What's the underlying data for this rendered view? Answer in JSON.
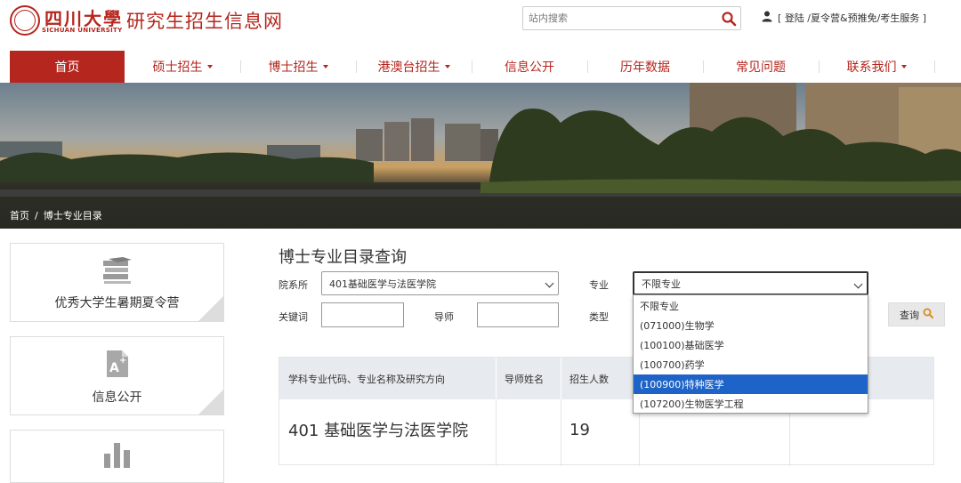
{
  "header": {
    "logo_cn": "四川大學",
    "logo_en": "SICHUAN UNIVERSITY",
    "site_title": "研究生招生信息网",
    "search_placeholder": "站内搜索",
    "user_links": "[ 登陆 /夏令营&预推免/考生服务 ]"
  },
  "nav": {
    "items": [
      {
        "label": "首页"
      },
      {
        "label": "硕士招生"
      },
      {
        "label": "博士招生"
      },
      {
        "label": "港澳台招生"
      },
      {
        "label": "信息公开"
      },
      {
        "label": "历年数据"
      },
      {
        "label": "常见问题"
      },
      {
        "label": "联系我们"
      }
    ]
  },
  "breadcrumb": {
    "home": "首页",
    "separator": "/",
    "current": "博士专业目录"
  },
  "sidebar": {
    "cards": [
      {
        "label": "优秀大学生暑期夏令营",
        "icon": "graduation-cap-icon"
      },
      {
        "label": "信息公开",
        "icon": "document-a-plus-icon"
      },
      {
        "label": "",
        "icon": "bar-chart-icon"
      }
    ]
  },
  "main": {
    "title": "博士专业目录查询",
    "filters": {
      "department_label": "院系所",
      "department_value": "401基础医学与法医学院",
      "major_label": "专业",
      "major_value": "不限专业",
      "keyword_label": "关键词",
      "keyword_value": "",
      "advisor_label": "导师",
      "advisor_value": "",
      "type_label": "类型",
      "query_button": "查询"
    },
    "major_dropdown": {
      "options": [
        "不限专业",
        "(071000)生物学",
        "(100100)基础医学",
        "(100700)药学",
        "(100900)特种医学",
        "(107200)生物医学工程"
      ],
      "highlighted_index": 4
    },
    "table": {
      "headers": [
        "学科专业代码、专业名称及研究方向",
        "导师姓名",
        "招生人数",
        "",
        ""
      ],
      "rows": [
        [
          "401 基础医学与法医学院",
          "",
          "19",
          "",
          ""
        ]
      ]
    }
  },
  "colors": {
    "brand": "#b5261e",
    "highlight": "#1e63c7"
  }
}
